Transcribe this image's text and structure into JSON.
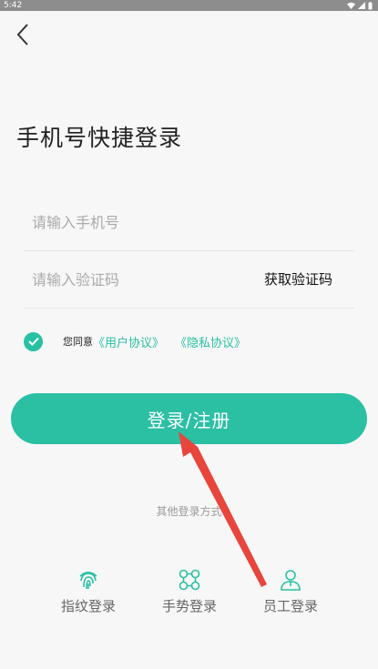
{
  "status_bar": {
    "time": "5:42"
  },
  "title": "手机号快捷登录",
  "phone_field": {
    "placeholder": "请输入手机号"
  },
  "code_field": {
    "placeholder": "请输入验证码",
    "get_code_label": "获取验证码"
  },
  "agreement": {
    "prefix": "您同意",
    "user_agreement": "《用户协议》",
    "privacy_policy": "《隐私协议》",
    "checked": true
  },
  "login_button": "登录/注册",
  "other_methods_label": "其他登录方式",
  "alt_logins": [
    {
      "label": "指纹登录",
      "icon": "fingerprint-icon"
    },
    {
      "label": "手势登录",
      "icon": "gesture-icon"
    },
    {
      "label": "员工登录",
      "icon": "employee-icon"
    }
  ],
  "colors": {
    "accent": "#2bbfa4",
    "annotation_arrow": "#e8453c"
  }
}
